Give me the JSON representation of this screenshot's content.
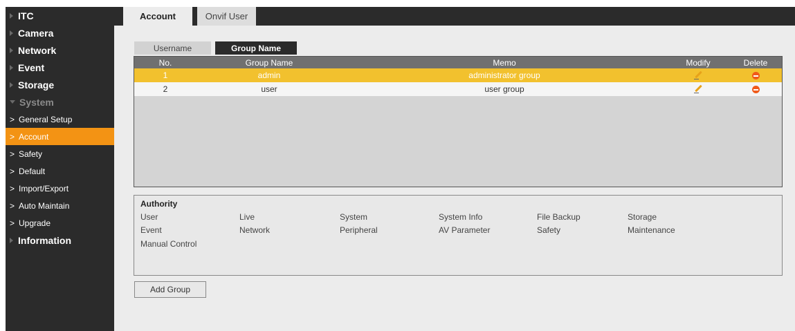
{
  "sidebar": {
    "items": [
      {
        "label": "ITC",
        "type": "top"
      },
      {
        "label": "Camera",
        "type": "top"
      },
      {
        "label": "Network",
        "type": "top"
      },
      {
        "label": "Event",
        "type": "top"
      },
      {
        "label": "Storage",
        "type": "top"
      },
      {
        "label": "System",
        "type": "top-open"
      },
      {
        "label": "General Setup",
        "type": "sub"
      },
      {
        "label": "Account",
        "type": "sub-active"
      },
      {
        "label": "Safety",
        "type": "sub"
      },
      {
        "label": "Default",
        "type": "sub"
      },
      {
        "label": "Import/Export",
        "type": "sub"
      },
      {
        "label": "Auto Maintain",
        "type": "sub"
      },
      {
        "label": "Upgrade",
        "type": "sub"
      },
      {
        "label": "Information",
        "type": "top"
      }
    ]
  },
  "tabs": {
    "account": "Account",
    "onvif": "Onvif User"
  },
  "subtabs": {
    "username": "Username",
    "group_name": "Group Name"
  },
  "table": {
    "headers": {
      "no": "No.",
      "group_name": "Group Name",
      "memo": "Memo",
      "modify": "Modify",
      "delete": "Delete"
    },
    "rows": [
      {
        "no": "1",
        "group_name": "admin",
        "memo": "administrator group",
        "selected": true
      },
      {
        "no": "2",
        "group_name": "user",
        "memo": "user group",
        "selected": false
      }
    ]
  },
  "authority": {
    "title": "Authority",
    "permissions": [
      [
        "User",
        "Live",
        "System",
        "System Info",
        "File Backup",
        "Storage"
      ],
      [
        "Event",
        "Network",
        "Peripheral",
        "AV Parameter",
        "Safety",
        "Maintenance"
      ],
      [
        "Manual Control"
      ]
    ]
  },
  "buttons": {
    "add_group": "Add Group"
  },
  "colors": {
    "accent": "#f39314",
    "selected_row": "#f2c12e",
    "sidebar_bg": "#2b2b2b",
    "delete_icon": "#f05a1a"
  }
}
